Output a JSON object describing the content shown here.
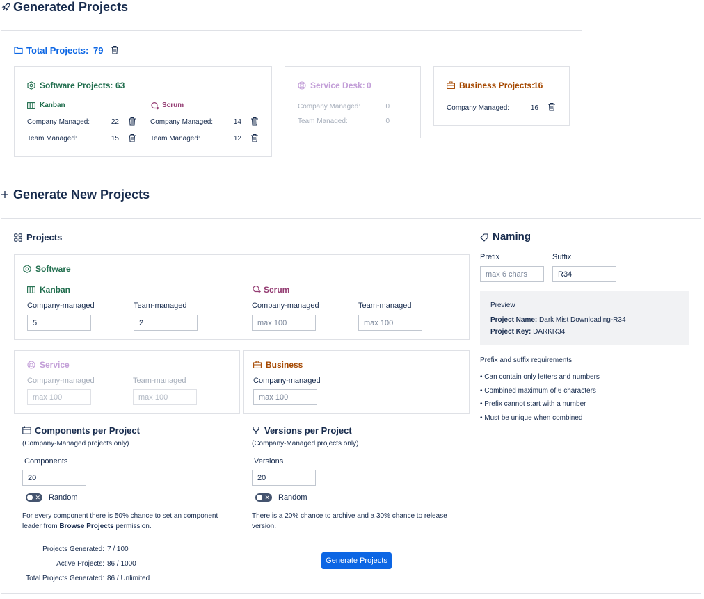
{
  "header": {
    "title": "Generated Projects"
  },
  "totals": {
    "label": "Total Projects:",
    "value": "79"
  },
  "software": {
    "label": "Software Projects:",
    "value": "63",
    "kanban": {
      "label": "Kanban",
      "company_label": "Company Managed:",
      "company_value": "22",
      "team_label": "Team Managed:",
      "team_value": "15"
    },
    "scrum": {
      "label": "Scrum",
      "company_label": "Company Managed:",
      "company_value": "14",
      "team_label": "Team Managed:",
      "team_value": "12"
    }
  },
  "service_desk": {
    "label": "Service Desk:",
    "value": "0",
    "company_label": "Company Managed:",
    "company_value": "0",
    "team_label": "Team Managed:",
    "team_value": "0"
  },
  "business": {
    "label": "Business Projects:",
    "value": "16",
    "company_label": "Company Managed:",
    "company_value": "16"
  },
  "generate": {
    "title": "Generate New Projects",
    "projects_title": "Projects",
    "software": {
      "title": "Software",
      "kanban": {
        "title": "Kanban",
        "company_label": "Company-managed",
        "company_value": "5",
        "team_label": "Team-managed",
        "team_value": "2"
      },
      "scrum": {
        "title": "Scrum",
        "company_label": "Company-managed",
        "company_placeholder": "max 100",
        "team_label": "Team-managed",
        "team_placeholder": "max 100"
      }
    },
    "service": {
      "title": "Service",
      "company_label": "Company-managed",
      "company_placeholder": "max 100",
      "team_label": "Team-managed",
      "team_placeholder": "max 100"
    },
    "business": {
      "title": "Business",
      "company_label": "Company-managed",
      "company_placeholder": "max 100"
    },
    "components": {
      "title": "Components per Project",
      "subtitle": "(Company-Managed projects only)",
      "field_label": "Components",
      "value": "20",
      "random_label": "Random",
      "note_pre": "For every component there is 50% chance to set an component leader from ",
      "note_bold": "Browse Projects",
      "note_post": " permission."
    },
    "versions": {
      "title": "Versions per Project",
      "subtitle": "(Company-Managed projects only)",
      "field_label": "Versions",
      "value": "20",
      "random_label": "Random",
      "note": "There is a 20% chance to archive and a 30% chance to release version."
    },
    "stats": [
      {
        "label": "Projects Generated:",
        "value": "7 / 100"
      },
      {
        "label": "Active Projects:",
        "value": "86 / 1000"
      },
      {
        "label": "Total Projects Generated:",
        "value": "86 / Unlimited"
      }
    ],
    "button_label": "Generate Projects"
  },
  "naming": {
    "title": "Naming",
    "prefix_label": "Prefix",
    "prefix_placeholder": "max 6 chars",
    "suffix_label": "Suffix",
    "suffix_value": "R34",
    "preview": {
      "title": "Preview",
      "name_label": "Project Name:",
      "name_value": "Dark Mist Downloading-R34",
      "key_label": "Project Key:",
      "key_value": "DARKR34"
    },
    "requirements_title": "Prefix and suffix requirements:",
    "requirements": [
      "• Can contain only letters and numbers",
      "• Combined maximum of 6 characters",
      "• Prefix cannot start with a number",
      "• Must be unique when combined"
    ]
  },
  "colors": {
    "software": "#216e4e",
    "scrum": "#943d73",
    "service": "#c39fd8",
    "business": "#a54800",
    "primary": "#0c66e4"
  }
}
